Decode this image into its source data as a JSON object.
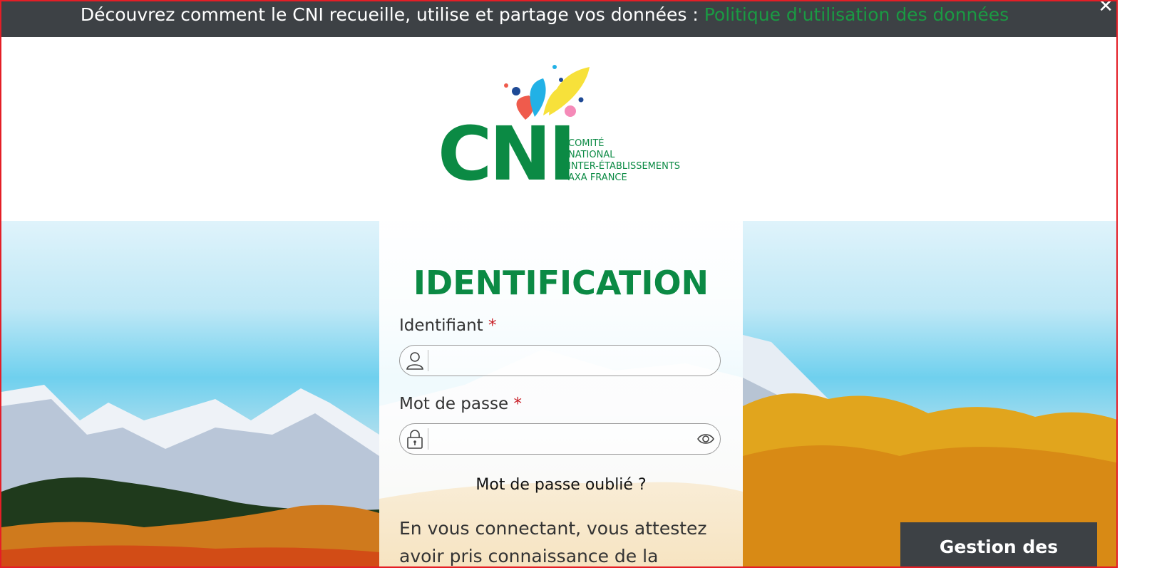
{
  "banner": {
    "text": "Découvrez comment le CNI recueille, utilise et partage vos données : ",
    "link_text": "Politique d'utilisation des données",
    "close_glyph": "✕"
  },
  "logo": {
    "letters": "CNI",
    "tagline": [
      "COMITÉ",
      "NATIONAL",
      "INTER-ÉTABLISSEMENTS",
      "AXA FRANCE"
    ]
  },
  "login": {
    "title": "IDENTIFICATION",
    "username_label": "Identifiant",
    "password_label": "Mot de passe",
    "required_mark": "*",
    "username_value": "",
    "password_value": "",
    "username_icon": "user-icon",
    "password_icon": "lock-icon",
    "toggle_icon": "eye-icon",
    "forgot_password": "Mot de passe oublié ?",
    "consent_text": "En vous connectant, vous attestez avoir pris connaissance de la"
  },
  "cookies": {
    "button_label": "Gestion des cookies"
  },
  "colors": {
    "brand_green": "#0b8a44",
    "banner_bg": "#3d4145",
    "required_red": "#c81d25",
    "link_green": "#1a9a43"
  }
}
